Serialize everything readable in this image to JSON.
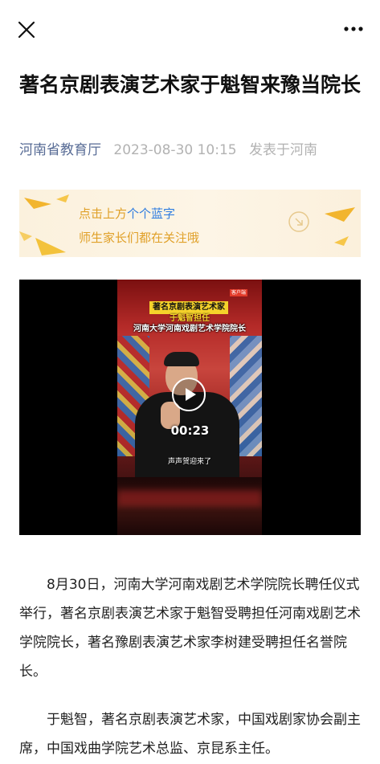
{
  "topbar": {
    "close_icon": "close-icon",
    "more_icon": "more-horizontal-icon"
  },
  "article": {
    "title": "著名京剧表演艺术家于魁智来豫当院长",
    "author": "河南省教育厅",
    "date": "2023-08-30 10:15",
    "location": "发表于河南"
  },
  "banner": {
    "line1_prefix": "点击上方",
    "line1_highlight": "个个蓝字",
    "line2": "师生家长们都在关注哦",
    "colors": {
      "text": "#e0a028",
      "highlight": "#2f7de0"
    }
  },
  "video": {
    "tag": "客户端",
    "caption_line1": "著名京剧表演艺术家",
    "caption_line2": "于魁智担任",
    "caption_line3": "河南大学河南戏剧艺术学院院长",
    "subtitle": "声声贺迎来了",
    "duration": "00:23",
    "play_icon": "play-icon"
  },
  "body": {
    "paragraph1": "8月30日，河南大学河南戏剧艺术学院院长聘任仪式举行，著名京剧表演艺术家于魁智受聘担任河南戏剧艺术学院院长，著名豫剧表演艺术家李树建受聘担任名誉院长。",
    "paragraph2": "于魁智，著名京剧表演艺术家，中国戏剧家协会副主席，中国戏曲学院艺术总监、京昆系主任。"
  },
  "colors": {
    "author_link": "#576b95",
    "meta_gray": "#b2b2b2"
  }
}
